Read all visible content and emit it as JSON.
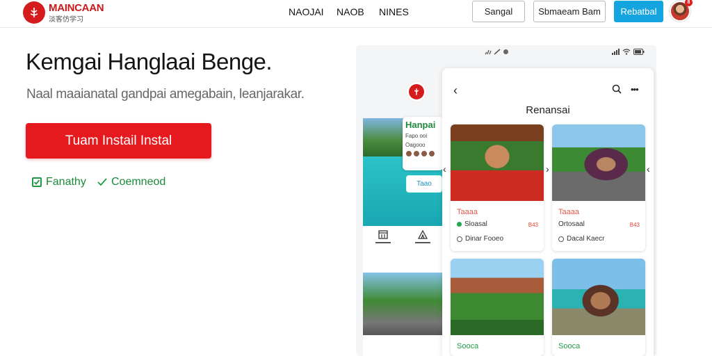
{
  "header": {
    "brand_name": "MAINCAAN",
    "brand_sub": "淡客仿学习",
    "nav": [
      "NAOJAI",
      "NAOB",
      "NINES"
    ],
    "signin_label": "Sangal",
    "secondary_label": "Sbmaeam Bam",
    "primary_label": "Rebatbal",
    "notification_count": "8"
  },
  "hero": {
    "title": "Kemgai Hanglaai Benge.",
    "subtitle": "Naal maaianatal gandpai amegabain, leanjarakar.",
    "cta_label": "Tuam Instail Instal",
    "checks": [
      "Fanathy",
      "Coemneod"
    ]
  },
  "phone_back": {
    "card_title": "Hanpai",
    "card_line1": "Fapo  ooi",
    "card_line2": "Oagooo",
    "button_label": "Taao"
  },
  "phone_front": {
    "title": "Renansai",
    "profiles": [
      {
        "name": "Taaaa",
        "status": "Sloasal",
        "tag": "B43",
        "location": "Dinar Fooeo"
      },
      {
        "name": "Taaaa",
        "status": "Ortosaal",
        "tag": "B43",
        "location": "Dacal Kaecr"
      },
      {
        "name": "Sooca",
        "status": "",
        "tag": "",
        "location": ""
      },
      {
        "name": "Sooca",
        "status": "",
        "tag": "",
        "location": ""
      }
    ]
  },
  "colors": {
    "brand_red": "#e6191e",
    "accent_blue": "#14a4df",
    "check_green": "#1f9b45"
  },
  "icons": [
    "logo-icon",
    "back-arrow-icon",
    "search-icon",
    "more-icon",
    "signal-icon",
    "wifi-icon",
    "battery-icon",
    "check-icon"
  ]
}
